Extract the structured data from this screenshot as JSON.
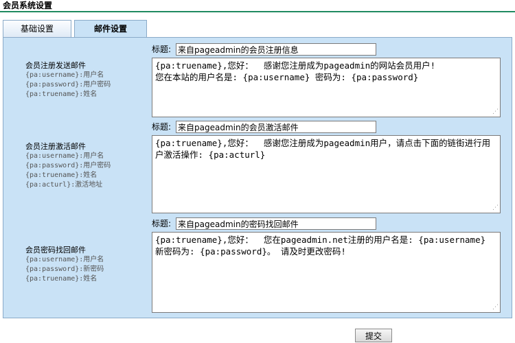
{
  "page": {
    "title": "会员系统设置"
  },
  "tabs": [
    {
      "label": "基础设置"
    },
    {
      "label": "邮件设置"
    }
  ],
  "sections": [
    {
      "name": "会员注册发送邮件",
      "vars": [
        "{pa:username}:用户名",
        "{pa:password}:用户密码",
        "{pa:truename}:姓名"
      ],
      "subject_label": "标题:",
      "subject": "来自pageadmin的会员注册信息",
      "body": "{pa:truename},您好：  感谢您注册成为pageadmin的网站会员用户!\n您在本站的用户名是: {pa:username} 密码为: {pa:password}"
    },
    {
      "name": "会员注册激活邮件",
      "vars": [
        "{pa:username}:用户名",
        "{pa:password}:用户密码",
        "{pa:truename}:姓名",
        "{pa:acturl}:激活地址"
      ],
      "subject_label": "标题:",
      "subject": "来自pageadmin的会员激活邮件",
      "body": "{pa:truename},您好：  感谢您注册成为pageadmin用户，请点击下面的链街进行用户激活操作: {pa:acturl}"
    },
    {
      "name": "会员密码找回邮件",
      "vars": [
        "{pa:username}:用户名",
        "{pa:password}:新密码",
        "{pa:truename}:姓名"
      ],
      "subject_label": "标题:",
      "subject": "来自pageadmin的密码找回邮件",
      "body": "{pa:truename},您好：  您在pageadmin.net注册的用户名是: {pa:username} 新密码为: {pa:password}。 请及时更改密码!"
    }
  ],
  "submit": {
    "label": "提交"
  },
  "colors": {
    "accent_rule": "#1f8a60",
    "panel_bg": "#c9e2f6"
  }
}
